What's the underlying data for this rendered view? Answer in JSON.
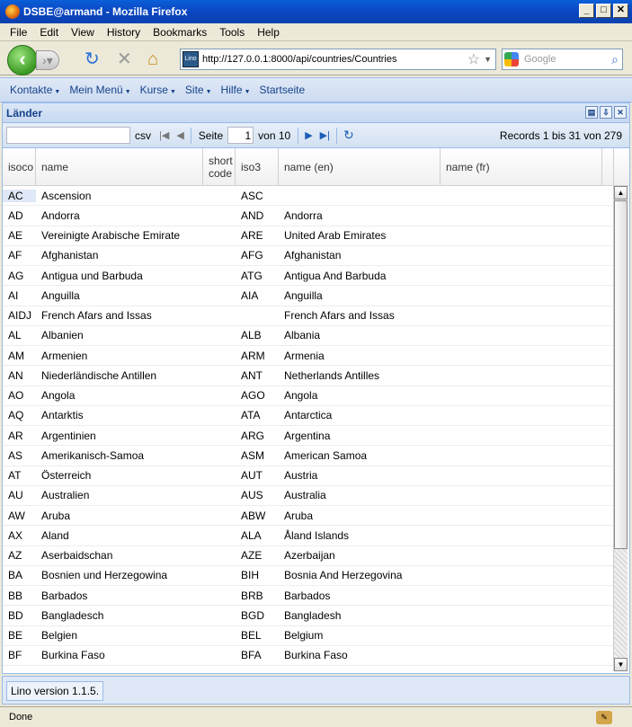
{
  "window": {
    "title": "DSBE@armand - Mozilla Firefox"
  },
  "menubar": [
    {
      "label": "File"
    },
    {
      "label": "Edit"
    },
    {
      "label": "View"
    },
    {
      "label": "History"
    },
    {
      "label": "Bookmarks"
    },
    {
      "label": "Tools"
    },
    {
      "label": "Help"
    }
  ],
  "url": "http://127.0.0.1:8000/api/countries/Countries",
  "url_site_badge": "Lino",
  "search_placeholder": "Google",
  "app_menu": [
    {
      "label": "Kontakte"
    },
    {
      "label": "Mein Menü"
    },
    {
      "label": "Kurse"
    },
    {
      "label": "Site"
    },
    {
      "label": "Hilfe"
    },
    {
      "label": "Startseite"
    }
  ],
  "panel_title": "Länder",
  "paging": {
    "csv": "csv",
    "page_label": "Seite",
    "page": "1",
    "of": "von 10",
    "records": "Records 1 bis 31 von 279"
  },
  "columns": [
    {
      "label": "isoco"
    },
    {
      "label": "name"
    },
    {
      "label": "short code"
    },
    {
      "label": "iso3"
    },
    {
      "label": "name (en)"
    },
    {
      "label": "name (fr)"
    }
  ],
  "rows": [
    {
      "isoco": "AC",
      "name": "Ascension",
      "short": "",
      "iso3": "ASC",
      "en": "",
      "fr": ""
    },
    {
      "isoco": "AD",
      "name": "Andorra",
      "short": "",
      "iso3": "AND",
      "en": "Andorra",
      "fr": ""
    },
    {
      "isoco": "AE",
      "name": "Vereinigte Arabische Emirate",
      "short": "",
      "iso3": "ARE",
      "en": "United Arab Emirates",
      "fr": ""
    },
    {
      "isoco": "AF",
      "name": "Afghanistan",
      "short": "",
      "iso3": "AFG",
      "en": "Afghanistan",
      "fr": ""
    },
    {
      "isoco": "AG",
      "name": "Antigua und Barbuda",
      "short": "",
      "iso3": "ATG",
      "en": "Antigua And Barbuda",
      "fr": ""
    },
    {
      "isoco": "AI",
      "name": "Anguilla",
      "short": "",
      "iso3": "AIA",
      "en": "Anguilla",
      "fr": ""
    },
    {
      "isoco": "AIDJ",
      "name": "French Afars and Issas",
      "short": "",
      "iso3": "",
      "en": "French Afars and Issas",
      "fr": ""
    },
    {
      "isoco": "AL",
      "name": "Albanien",
      "short": "",
      "iso3": "ALB",
      "en": "Albania",
      "fr": ""
    },
    {
      "isoco": "AM",
      "name": "Armenien",
      "short": "",
      "iso3": "ARM",
      "en": "Armenia",
      "fr": ""
    },
    {
      "isoco": "AN",
      "name": "Niederländische Antillen",
      "short": "",
      "iso3": "ANT",
      "en": "Netherlands Antilles",
      "fr": ""
    },
    {
      "isoco": "AO",
      "name": "Angola",
      "short": "",
      "iso3": "AGO",
      "en": "Angola",
      "fr": ""
    },
    {
      "isoco": "AQ",
      "name": "Antarktis",
      "short": "",
      "iso3": "ATA",
      "en": "Antarctica",
      "fr": ""
    },
    {
      "isoco": "AR",
      "name": "Argentinien",
      "short": "",
      "iso3": "ARG",
      "en": "Argentina",
      "fr": ""
    },
    {
      "isoco": "AS",
      "name": "Amerikanisch-Samoa",
      "short": "",
      "iso3": "ASM",
      "en": "American Samoa",
      "fr": ""
    },
    {
      "isoco": "AT",
      "name": "Österreich",
      "short": "",
      "iso3": "AUT",
      "en": "Austria",
      "fr": ""
    },
    {
      "isoco": "AU",
      "name": "Australien",
      "short": "",
      "iso3": "AUS",
      "en": "Australia",
      "fr": ""
    },
    {
      "isoco": "AW",
      "name": "Aruba",
      "short": "",
      "iso3": "ABW",
      "en": "Aruba",
      "fr": ""
    },
    {
      "isoco": "AX",
      "name": "Aland",
      "short": "",
      "iso3": "ALA",
      "en": "Åland Islands",
      "fr": ""
    },
    {
      "isoco": "AZ",
      "name": "Aserbaidschan",
      "short": "",
      "iso3": "AZE",
      "en": "Azerbaijan",
      "fr": ""
    },
    {
      "isoco": "BA",
      "name": "Bosnien und Herzegowina",
      "short": "",
      "iso3": "BIH",
      "en": "Bosnia And Herzegovina",
      "fr": ""
    },
    {
      "isoco": "BB",
      "name": "Barbados",
      "short": "",
      "iso3": "BRB",
      "en": "Barbados",
      "fr": ""
    },
    {
      "isoco": "BD",
      "name": "Bangladesch",
      "short": "",
      "iso3": "BGD",
      "en": "Bangladesh",
      "fr": ""
    },
    {
      "isoco": "BE",
      "name": "Belgien",
      "short": "",
      "iso3": "BEL",
      "en": "Belgium",
      "fr": ""
    },
    {
      "isoco": "BF",
      "name": "Burkina Faso",
      "short": "",
      "iso3": "BFA",
      "en": "Burkina Faso",
      "fr": ""
    }
  ],
  "footer": {
    "version": "Lino version 1.1.5."
  },
  "status": {
    "text": "Done"
  }
}
